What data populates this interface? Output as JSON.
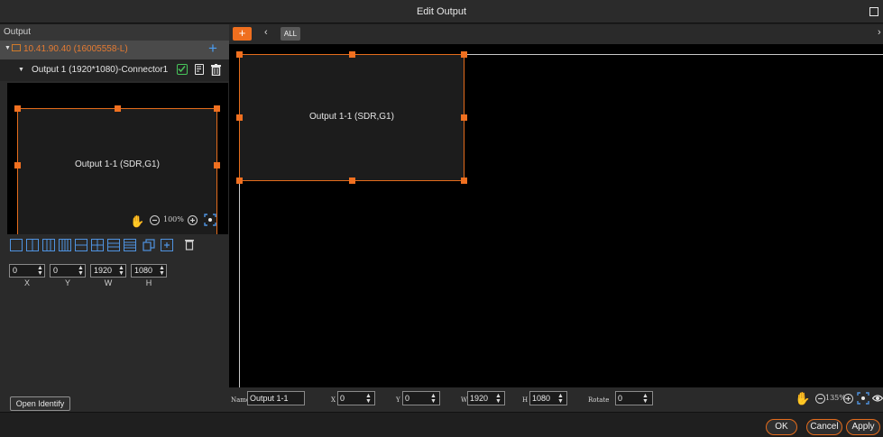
{
  "window": {
    "title": "Edit Output"
  },
  "left": {
    "header": "Output",
    "device_label": "10.41.90.40  (16005558-L)",
    "connector_label": "Output 1 (1920*1080)-Connector1",
    "preview_output_label": "Output 1-1 (SDR,G1)",
    "zoom_text": "100%",
    "fields": {
      "x": {
        "value": "0",
        "label": "X"
      },
      "y": {
        "value": "0",
        "label": "Y"
      },
      "w": {
        "value": "1920",
        "label": "W"
      },
      "h": {
        "value": "1080",
        "label": "H"
      }
    },
    "open_identify": "Open Identify"
  },
  "toolbar": {
    "add_label": "+",
    "all_label": "ALL"
  },
  "canvas": {
    "output_label": "Output 1-1 (SDR,G1)"
  },
  "props": {
    "name_label": "Name",
    "name_value": "Output 1-1",
    "x_label": "X",
    "x_value": "0",
    "y_label": "Y",
    "y_value": "0",
    "w_label": "W",
    "w_value": "1920",
    "h_label": "H",
    "h_value": "1080",
    "rotate_label": "Rotate",
    "rotate_value": "0",
    "zoom_text": "135%"
  },
  "footer": {
    "ok": "OK",
    "cancel": "Cancel",
    "apply": "Apply"
  },
  "colors": {
    "accent": "#ef6f1f",
    "selection": "#e46c1c",
    "link_blue": "#4a9cf0",
    "ok_green": "#47c45a"
  }
}
